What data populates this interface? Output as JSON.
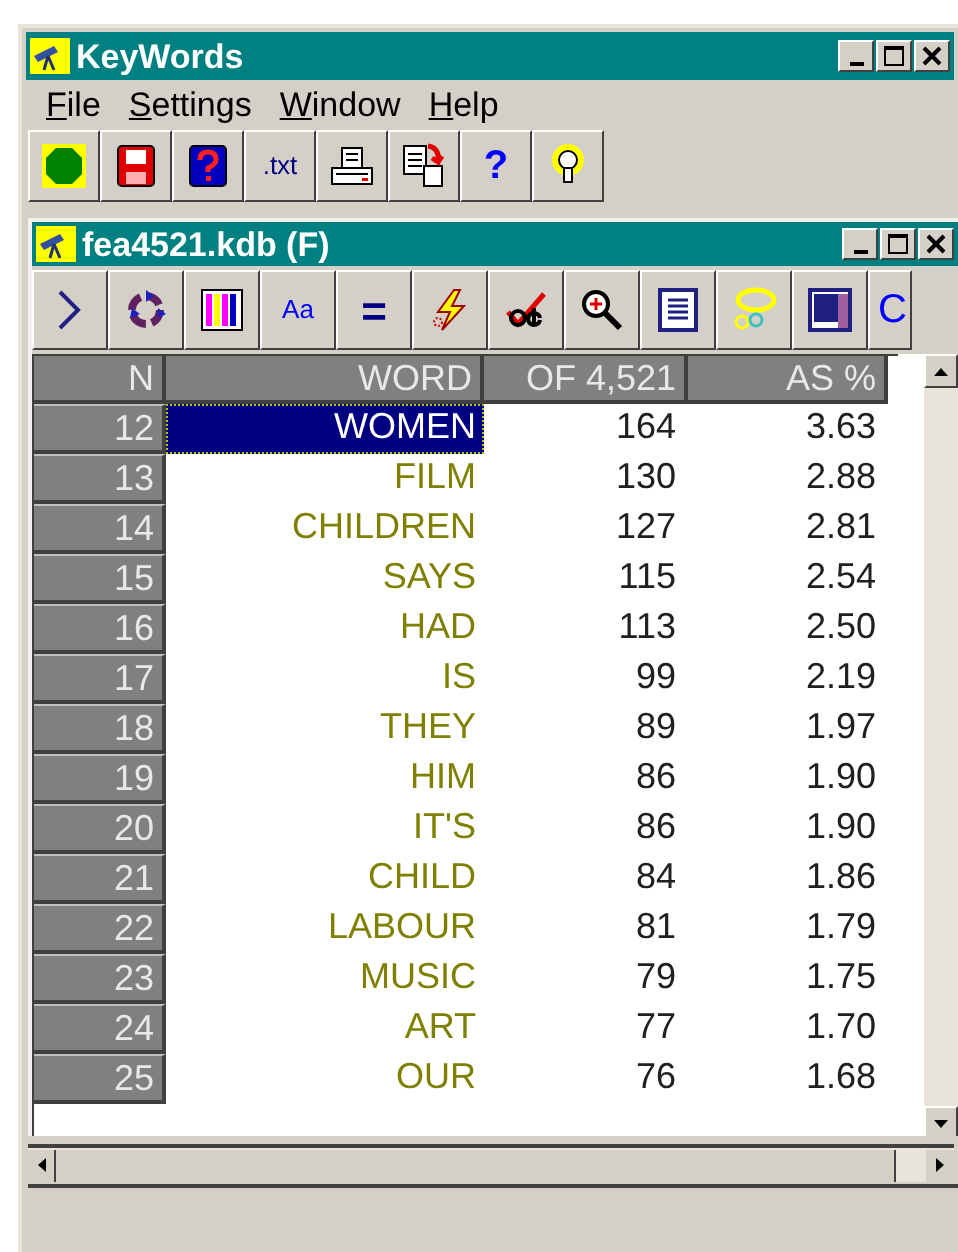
{
  "window": {
    "title": "KeyWords"
  },
  "menu": [
    "File",
    "Settings",
    "Window",
    "Help"
  ],
  "toolbar": [
    {
      "kind": "stop"
    },
    {
      "kind": "save"
    },
    {
      "kind": "helpbook"
    },
    {
      "kind": "text",
      "label": ".txt"
    },
    {
      "kind": "print"
    },
    {
      "kind": "copy"
    },
    {
      "kind": "question",
      "label": "?"
    },
    {
      "kind": "bulb"
    }
  ],
  "document_window": {
    "title": "fea4521.kdb (F)",
    "toolbar": [
      {
        "kind": "chevron"
      },
      {
        "kind": "recycle"
      },
      {
        "kind": "columns"
      },
      {
        "kind": "text",
        "label": "Aa"
      },
      {
        "kind": "equals",
        "label": "="
      },
      {
        "kind": "lightning"
      },
      {
        "kind": "edit"
      },
      {
        "kind": "zoom"
      },
      {
        "kind": "document"
      },
      {
        "kind": "ovals"
      },
      {
        "kind": "square"
      },
      {
        "kind": "letter",
        "label": "C"
      }
    ],
    "table": {
      "columns": [
        "N",
        "WORD",
        "OF 4,521",
        "AS %"
      ],
      "rows": [
        {
          "n": "12",
          "word": "WOMEN",
          "count": "164",
          "percent": "3.63",
          "selected": true
        },
        {
          "n": "13",
          "word": "FILM",
          "count": "130",
          "percent": "2.88",
          "selected": false
        },
        {
          "n": "14",
          "word": "CHILDREN",
          "count": "127",
          "percent": "2.81",
          "selected": false
        },
        {
          "n": "15",
          "word": "SAYS",
          "count": "115",
          "percent": "2.54",
          "selected": false
        },
        {
          "n": "16",
          "word": "HAD",
          "count": "113",
          "percent": "2.50",
          "selected": false
        },
        {
          "n": "17",
          "word": "IS",
          "count": "99",
          "percent": "2.19",
          "selected": false
        },
        {
          "n": "18",
          "word": "THEY",
          "count": "89",
          "percent": "1.97",
          "selected": false
        },
        {
          "n": "19",
          "word": "HIM",
          "count": "86",
          "percent": "1.90",
          "selected": false
        },
        {
          "n": "20",
          "word": "IT'S",
          "count": "86",
          "percent": "1.90",
          "selected": false
        },
        {
          "n": "21",
          "word": "CHILD",
          "count": "84",
          "percent": "1.86",
          "selected": false
        },
        {
          "n": "22",
          "word": "LABOUR",
          "count": "81",
          "percent": "1.79",
          "selected": false
        },
        {
          "n": "23",
          "word": "MUSIC",
          "count": "79",
          "percent": "1.75",
          "selected": false
        },
        {
          "n": "24",
          "word": "ART",
          "count": "77",
          "percent": "1.70",
          "selected": false
        },
        {
          "n": "25",
          "word": "OUR",
          "count": "76",
          "percent": "1.68",
          "selected": false
        }
      ]
    }
  }
}
